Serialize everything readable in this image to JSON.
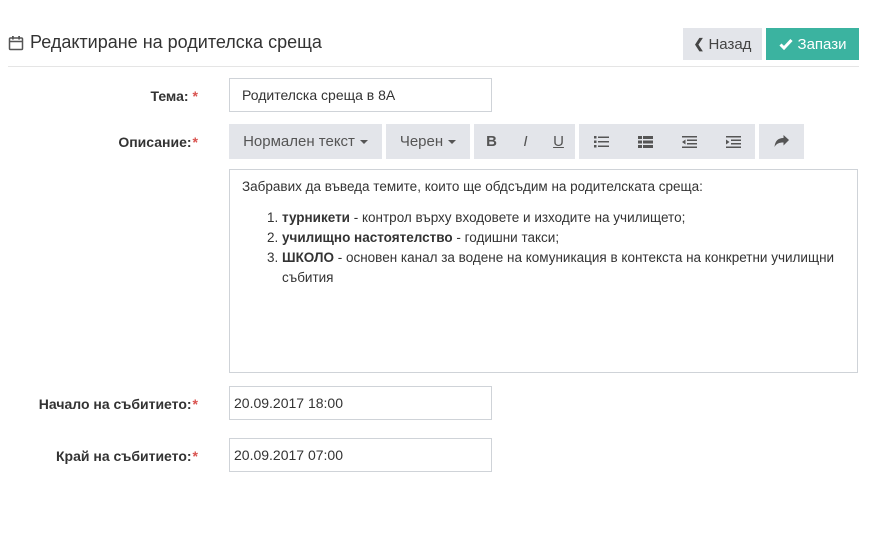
{
  "header": {
    "title": "Редактиране на родителска среща",
    "back_label": "Назад",
    "save_label": "Запази"
  },
  "form": {
    "topic_label": "Тема:",
    "topic_value": "Родителска среща в 8А",
    "description_label": "Описание:",
    "start_label": "Начало на събитието:",
    "start_value": "20.09.2017 18:00",
    "end_label": "Край на събитието:",
    "end_value": "20.09.2017 07:00",
    "required_mark": "*"
  },
  "toolbar": {
    "style_select": "Нормален текст",
    "color_select": "Черен",
    "bold": "B",
    "italic": "I",
    "underline": "U"
  },
  "editor": {
    "intro": "Забравих да въведа темите, които ще обдсъдим на родителската среща:",
    "items": [
      {
        "bold": "турникети",
        "rest": " - контрол върху входовете и изходите на училището;"
      },
      {
        "bold": "училищно настоятелство",
        "rest": " - годишни такси;"
      },
      {
        "bold": "ШКОЛО",
        "rest": " - основен канал за водене на комуникация в контекста на конкретни училищни събития"
      }
    ]
  },
  "colors": {
    "accent": "#3bb3a0",
    "button_gray": "#e3e5ea",
    "required": "#d9534f"
  }
}
